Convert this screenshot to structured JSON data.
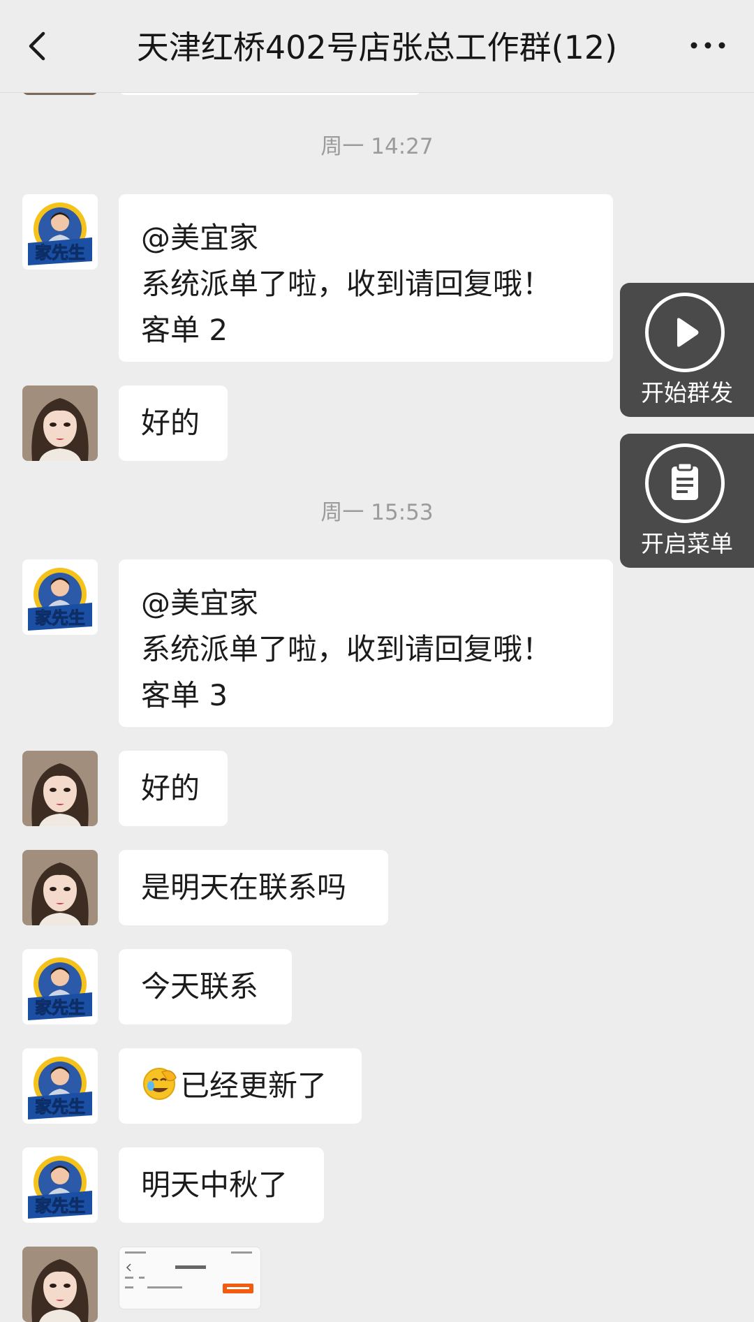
{
  "header": {
    "title": "天津红桥402号店张总工作群(12)",
    "back_icon": "chevron-left-icon",
    "more_icon": "more-dots-icon"
  },
  "timestamps": [
    "周一 14:27",
    "周一 15:53"
  ],
  "messages": [
    {
      "sender": "family-logo",
      "lines": [
        "@美宜家",
        "系统派单了啦，收到请回复哦！",
        "客单 2"
      ]
    },
    {
      "sender": "girl",
      "lines": [
        "好的"
      ]
    },
    {
      "sender": "family-logo",
      "lines": [
        "@美宜家",
        "系统派单了啦，收到请回复哦！",
        "客单 3"
      ]
    },
    {
      "sender": "girl",
      "lines": [
        "好的"
      ]
    },
    {
      "sender": "girl",
      "lines": [
        "是明天在联系吗"
      ]
    },
    {
      "sender": "family-logo",
      "lines": [
        "今天联系"
      ]
    },
    {
      "sender": "family-logo",
      "emoji": "facepalm-laugh-emoji",
      "lines": [
        "已经更新了"
      ]
    },
    {
      "sender": "family-logo",
      "lines": [
        "明天中秋了"
      ]
    },
    {
      "sender": "girl",
      "type": "image"
    }
  ],
  "floating": {
    "broadcast": {
      "label": "开始群发",
      "icon": "play-icon"
    },
    "menu": {
      "label": "开启菜单",
      "icon": "clipboard-icon"
    }
  },
  "avatar_logo_text": "家先生",
  "colors": {
    "background": "#ededed",
    "bubble": "#ffffff",
    "fab": "#4a4a4a"
  }
}
